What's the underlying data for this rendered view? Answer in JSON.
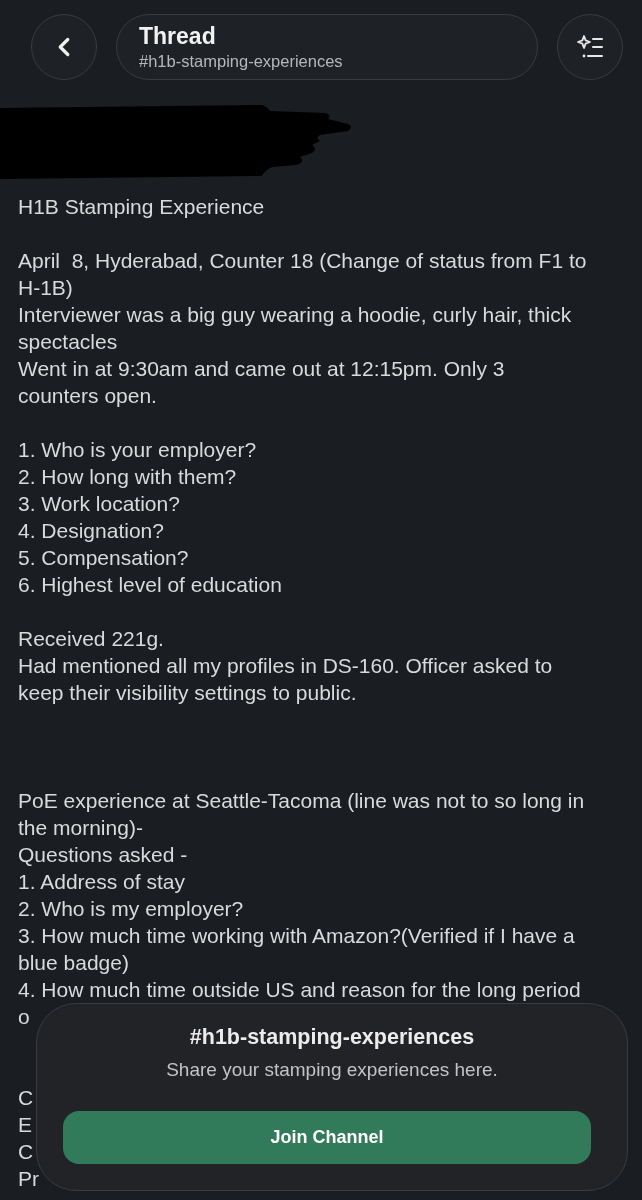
{
  "header": {
    "title": "Thread",
    "channel": "#h1b-stamping-experiences"
  },
  "message": {
    "lines": [
      {
        "kind": "text",
        "text": "H1B Stamping Experience"
      },
      {
        "kind": "blank"
      },
      {
        "kind": "text",
        "text": "April  8, Hyderabad, Counter 18 (Change of status from F1 to H-1B)"
      },
      {
        "kind": "text",
        "text": "Interviewer was a big guy wearing a hoodie, curly hair, thick spectacles"
      },
      {
        "kind": "text",
        "text": "Went in at 9:30am and came out at 12:15pm. Only 3 counters open."
      },
      {
        "kind": "blank"
      },
      {
        "kind": "text",
        "text": "1. Who is your employer?"
      },
      {
        "kind": "text",
        "text": "2. How long with them?"
      },
      {
        "kind": "text",
        "text": "3. Work location?"
      },
      {
        "kind": "text",
        "text": "4. Designation?"
      },
      {
        "kind": "text",
        "text": "5. Compensation?"
      },
      {
        "kind": "text",
        "text": "6. Highest level of education"
      },
      {
        "kind": "blank"
      },
      {
        "kind": "text",
        "text": "Received 221g."
      },
      {
        "kind": "text",
        "text": "Had mentioned all my profiles in DS-160. Officer asked to keep their visibility settings to public."
      },
      {
        "kind": "blank"
      },
      {
        "kind": "blank"
      },
      {
        "kind": "blank"
      },
      {
        "kind": "text",
        "text": "PoE experience at Seattle-Tacoma (line was not to so long in the morning)-"
      },
      {
        "kind": "text",
        "text": "Questions asked -"
      },
      {
        "kind": "text",
        "text": "1. Address of stay"
      },
      {
        "kind": "text",
        "text": "2. Who is my employer?"
      },
      {
        "kind": "text",
        "text": "3. How much time working with Amazon?(Verified if I have a blue badge)"
      },
      {
        "kind": "text",
        "text": "4. How much time outside US and reason for the long period"
      },
      {
        "kind": "text",
        "text": "o"
      },
      {
        "kind": "blank"
      },
      {
        "kind": "blank"
      },
      {
        "kind": "text",
        "text": "C"
      },
      {
        "kind": "text",
        "text": "E"
      },
      {
        "kind": "text",
        "text": "C"
      },
      {
        "kind": "text",
        "text": "Pr"
      }
    ]
  },
  "join_panel": {
    "channel": "#h1b-stamping-experiences",
    "description": "Share your stamping experiences here.",
    "button": "Join Channel"
  }
}
